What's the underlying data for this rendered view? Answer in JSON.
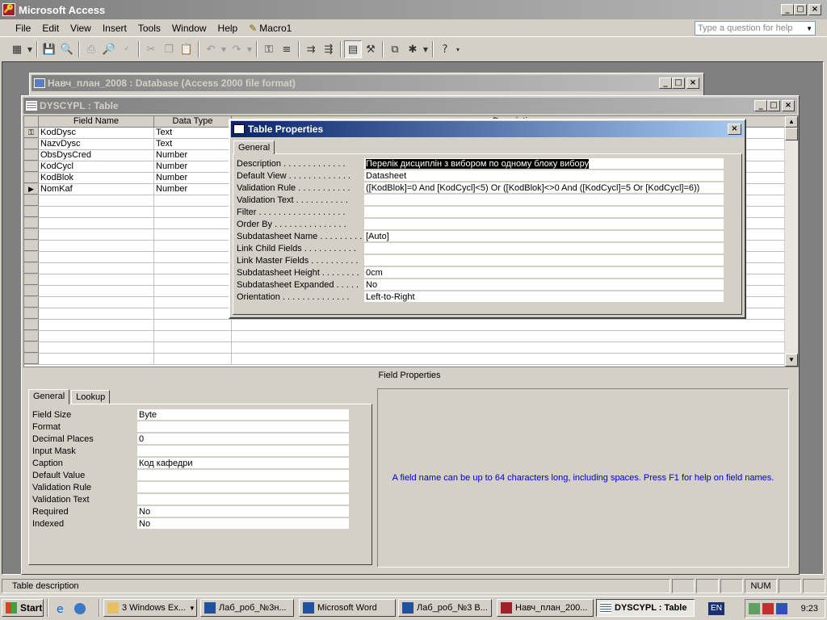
{
  "app": {
    "title": "Microsoft Access"
  },
  "menu": {
    "items": [
      "File",
      "Edit",
      "View",
      "Insert",
      "Tools",
      "Window",
      "Help"
    ],
    "macro": "Macro1",
    "help_placeholder": "Type a question for help"
  },
  "db_window": {
    "title": "Навч_план_2008 : Database (Access 2000 file format)"
  },
  "table_window": {
    "title": "DYSCYPL : Table",
    "headers": {
      "field_name": "Field Name",
      "data_type": "Data Type",
      "description": "Description"
    },
    "rows": [
      {
        "name": "KodDysc",
        "type": "Text"
      },
      {
        "name": "NazvDysc",
        "type": "Text"
      },
      {
        "name": "ObsDysCred",
        "type": "Number"
      },
      {
        "name": "KodCycl",
        "type": "Number"
      },
      {
        "name": "KodBlok",
        "type": "Number"
      },
      {
        "name": "NomKaf",
        "type": "Number"
      }
    ],
    "field_properties_label": "Field Properties",
    "tabs": {
      "general": "General",
      "lookup": "Lookup"
    },
    "props": [
      {
        "label": "Field Size",
        "value": "Byte"
      },
      {
        "label": "Format",
        "value": ""
      },
      {
        "label": "Decimal Places",
        "value": "0"
      },
      {
        "label": "Input Mask",
        "value": ""
      },
      {
        "label": "Caption",
        "value": "Код кафедри"
      },
      {
        "label": "Default Value",
        "value": ""
      },
      {
        "label": "Validation Rule",
        "value": ""
      },
      {
        "label": "Validation Text",
        "value": ""
      },
      {
        "label": "Required",
        "value": "No"
      },
      {
        "label": "Indexed",
        "value": "No"
      }
    ],
    "hint": "A field name can be up to 64 characters long, including spaces.  Press F1 for help on field names."
  },
  "table_props": {
    "title": "Table Properties",
    "tab": "General",
    "rows": [
      {
        "label": "Description . . . . . . . . . . . . .",
        "value": "Перелік дисциплін з вибором по одному блоку вибору"
      },
      {
        "label": "Default View . . . . . . . . . . . . .",
        "value": "Datasheet"
      },
      {
        "label": "Validation Rule . . . . . . . . . . .",
        "value": "([KodBlok]=0 And [KodCycl]<5) Or ([KodBlok]<>0 And ([KodCycl]=5 Or [KodCycl]=6))"
      },
      {
        "label": "Validation Text . . . . . . . . . . .",
        "value": ""
      },
      {
        "label": "Filter . . . . . . . . . . . . . . . . . .",
        "value": ""
      },
      {
        "label": "Order By . . . . . . . . . . . . . . .",
        "value": ""
      },
      {
        "label": "Subdatasheet Name . . . . . . . . .",
        "value": "[Auto]"
      },
      {
        "label": "Link Child Fields . . . . . . . . . . .",
        "value": ""
      },
      {
        "label": "Link Master Fields . . . . . . . . . .",
        "value": ""
      },
      {
        "label": "Subdatasheet Height . . . . . . . .",
        "value": "0cm"
      },
      {
        "label": "Subdatasheet Expanded . . . . .",
        "value": "No"
      },
      {
        "label": "Orientation . . . . . . . . . . . . . .",
        "value": "Left-to-Right"
      }
    ]
  },
  "status": {
    "text": "Table description",
    "num": "NUM"
  },
  "taskbar": {
    "start": "Start",
    "buttons": [
      "3 Windows Ex...",
      "Лаб_роб_№3н...",
      "Microsoft Word",
      "Лаб_роб_№3 В...",
      "Навч_план_200...",
      "DYSCYPL : Table"
    ],
    "lang": "EN",
    "clock": "9:23"
  },
  "colors": {
    "titlebar": "#0a246a",
    "hint_text": "#0000cc",
    "selection": "#000000"
  }
}
